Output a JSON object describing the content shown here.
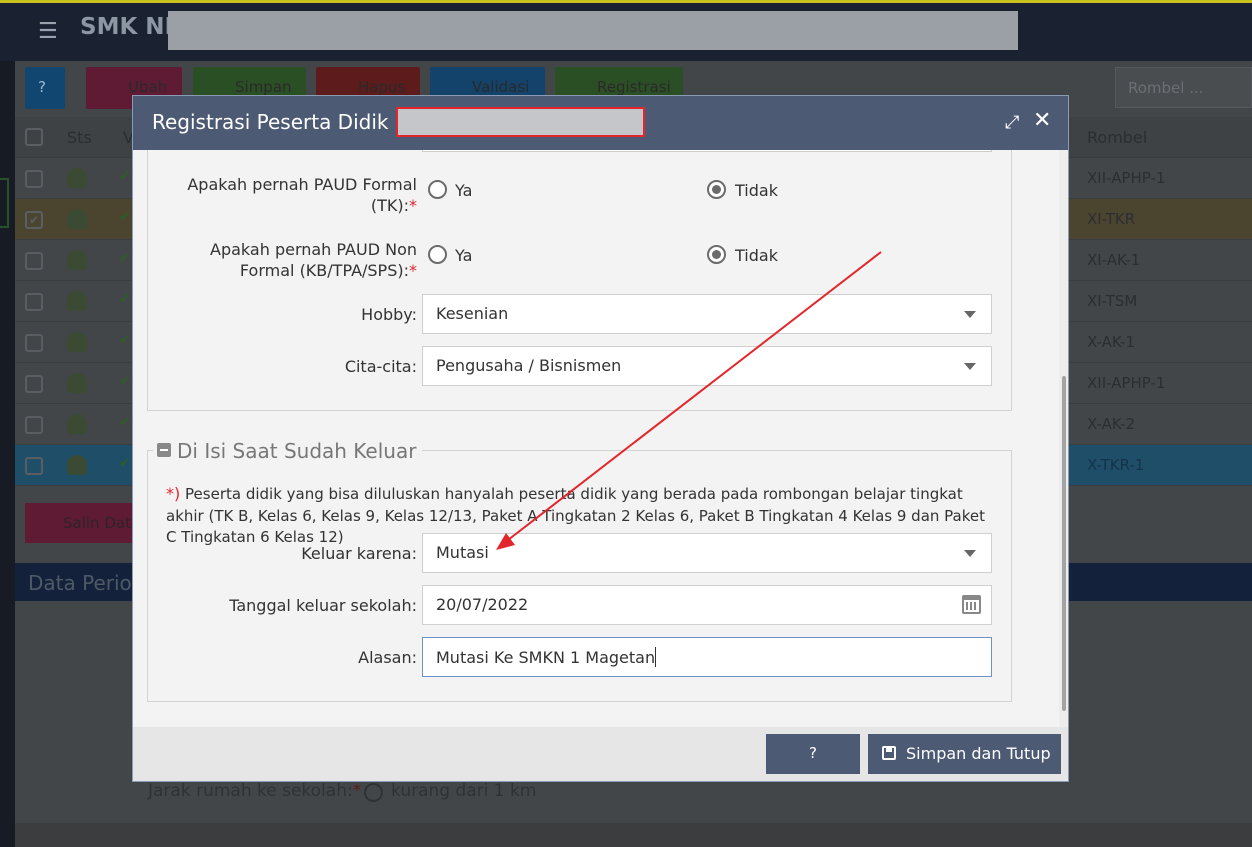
{
  "background_app": {
    "app_name": "SMK NE",
    "toolbar": {
      "help_icon": "?",
      "ubah_label": "Ubah",
      "simpan_label": "Simpan",
      "hapus_label": "Hapus",
      "validasi_label": "Validasi",
      "registrasi_label": "Registrasi"
    },
    "search_placeholder": "Rombel ...",
    "grid": {
      "col_sts": "Sts",
      "col_v": "V",
      "col_rombel": "Rombel",
      "rows": [
        {
          "rombel": "XII-APHP-1",
          "checked": false
        },
        {
          "rombel": "XI-TKR",
          "checked": true
        },
        {
          "rombel": "XI-AK-1",
          "checked": false
        },
        {
          "rombel": "XI-TSM",
          "checked": false
        },
        {
          "rombel": "X-AK-1",
          "checked": false
        },
        {
          "rombel": "XII-APHP-1",
          "checked": false
        },
        {
          "rombel": "X-AK-2",
          "checked": false
        },
        {
          "rombel": "X-TKR-1",
          "checked": false
        }
      ]
    },
    "salin_label": "Salin Dat",
    "data_periodik_label": "Data Perio",
    "jarak": {
      "label": "Jarak rumah ke sekolah:",
      "required": "*",
      "option": "kurang dari 1 km"
    }
  },
  "modal": {
    "title": "Registrasi Peserta Didik :",
    "fields": {
      "paud_formal": {
        "label_line1": "Apakah pernah PAUD Formal",
        "label_line2": "(TK):",
        "required": "*",
        "opt_yes": "Ya",
        "opt_no": "Tidak",
        "selected": "Tidak"
      },
      "paud_nonformal": {
        "label_line1": "Apakah pernah PAUD Non",
        "label_line2": "Formal (KB/TPA/SPS):",
        "required": "*",
        "opt_yes": "Ya",
        "opt_no": "Tidak",
        "selected": "Tidak"
      },
      "hobby": {
        "label": "Hobby:",
        "value": "Kesenian"
      },
      "cita_cita": {
        "label": "Cita-cita:",
        "value": "Pengusaha / Bisnismen"
      }
    },
    "section_keluar": {
      "legend": "Di Isi Saat Sudah Keluar",
      "note_marker": "*)",
      "note": "Peserta didik yang bisa diluluskan hanyalah peserta didik yang berada pada rombongan belajar tingkat akhir (TK B, Kelas 6, Kelas 9, Kelas 12/13, Paket A Tingkatan 2 Kelas 6, Paket B Tingkatan 4 Kelas 9 dan Paket C Tingkatan 6 Kelas 12)",
      "keluar_karena": {
        "label": "Keluar karena:",
        "value": "Mutasi"
      },
      "tanggal_keluar": {
        "label": "Tanggal keluar sekolah:",
        "value": "20/07/2022"
      },
      "alasan": {
        "label": "Alasan:",
        "value": "Mutasi Ke SMKN 1 Magetan"
      }
    },
    "footer": {
      "help_label": "?",
      "save_label": "Simpan dan Tutup"
    }
  },
  "colors": {
    "modal_header": "#4c5a74",
    "required": "#e3262b",
    "annotation_arrow": "#e3262b"
  }
}
